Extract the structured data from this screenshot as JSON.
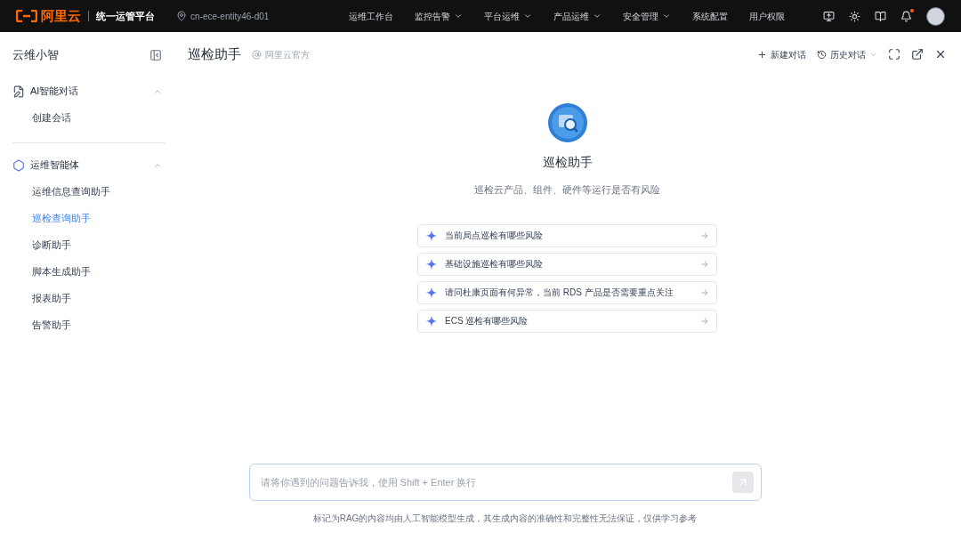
{
  "topbar": {
    "logo": "阿里云",
    "platform": "统一运管平台",
    "location": "cn-ece-entity46-d01",
    "nav": [
      {
        "label": "运维工作台",
        "dropdown": false
      },
      {
        "label": "监控告警",
        "dropdown": true
      },
      {
        "label": "平台运维",
        "dropdown": true
      },
      {
        "label": "产品运维",
        "dropdown": true
      },
      {
        "label": "安全管理",
        "dropdown": true
      },
      {
        "label": "系统配置",
        "dropdown": false
      },
      {
        "label": "用户权限",
        "dropdown": false
      }
    ],
    "unread_notifications": true
  },
  "sidebar": {
    "title": "云维小智",
    "groups": [
      {
        "kind": "chat",
        "label": "AI智能对话",
        "expanded": true,
        "items": [
          {
            "label": "创建会话",
            "selected": false
          }
        ]
      },
      {
        "kind": "agent",
        "label": "运维智能体",
        "expanded": true,
        "items": [
          {
            "label": "运维信息查询助手",
            "selected": false
          },
          {
            "label": "巡检查询助手",
            "selected": true
          },
          {
            "label": "诊断助手",
            "selected": false
          },
          {
            "label": "脚本生成助手",
            "selected": false
          },
          {
            "label": "报表助手",
            "selected": false
          },
          {
            "label": "告警助手",
            "selected": false
          }
        ]
      }
    ]
  },
  "header": {
    "title": "巡检助手",
    "author": "阿里云官方",
    "actions": [
      "新建对话",
      "历史对话"
    ]
  },
  "assistant": {
    "name": "巡检助手",
    "description": "巡检云产品、组件、硬件等运行是否有风险",
    "suggestions": [
      "当前局点巡检有哪些风险",
      "基础设施巡检有哪些风险",
      "请问杜康页面有何异常，当前 RDS 产品是否需要重点关注",
      "ECS 巡检有哪些风险"
    ]
  },
  "input": {
    "placeholder": "请将你遇到的问题告诉我，使用 Shift + Enter 换行"
  },
  "disclaimer": "标记为RAG的内容均由人工智能模型生成，其生成内容的准确性和完整性无法保证，仅供学习参考"
}
